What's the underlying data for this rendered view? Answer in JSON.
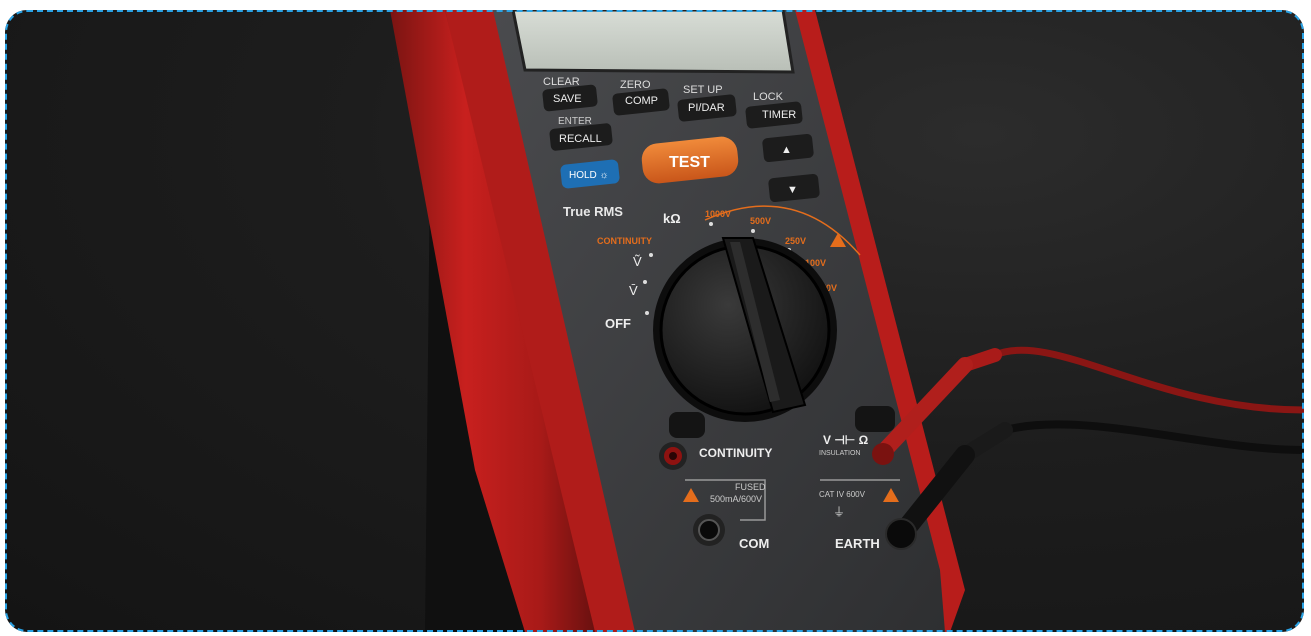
{
  "buttons": {
    "clear": "CLEAR",
    "save": "SAVE",
    "zero": "ZERO",
    "comp": "COMP",
    "setup": "SET UP",
    "pidar": "PI/DAR",
    "lock": "LOCK",
    "timer": "TIMER",
    "enter": "ENTER",
    "recall": "RECALL",
    "hold": "HOLD ☼",
    "test": "TEST",
    "up": "▲",
    "down": "▼"
  },
  "panel": {
    "true_rms": "True RMS",
    "kohm": "kΩ",
    "v1000": "1000V",
    "v500": "500V",
    "v250": "250V",
    "v100": "100V",
    "v50": "50V",
    "continuity_small": "CONTINUITY",
    "v_ac": "Ṽ",
    "v_dc": "V̄",
    "off": "OFF",
    "continuity": "CONTINUITY",
    "fused": "FUSED",
    "fuse_rating": "500mA/600V",
    "com": "COM",
    "v_terminal": "V ⊣⊢ Ω",
    "insulation": "INSULATION",
    "cat": "CAT IV 600V",
    "earth": "EARTH"
  },
  "colors": {
    "body_red": "#c8201e",
    "panel_gray": "#3e3f42",
    "accent_orange": "#e46d1c",
    "hold_blue": "#1e6fb4",
    "frame_border": "#29a3e6"
  }
}
